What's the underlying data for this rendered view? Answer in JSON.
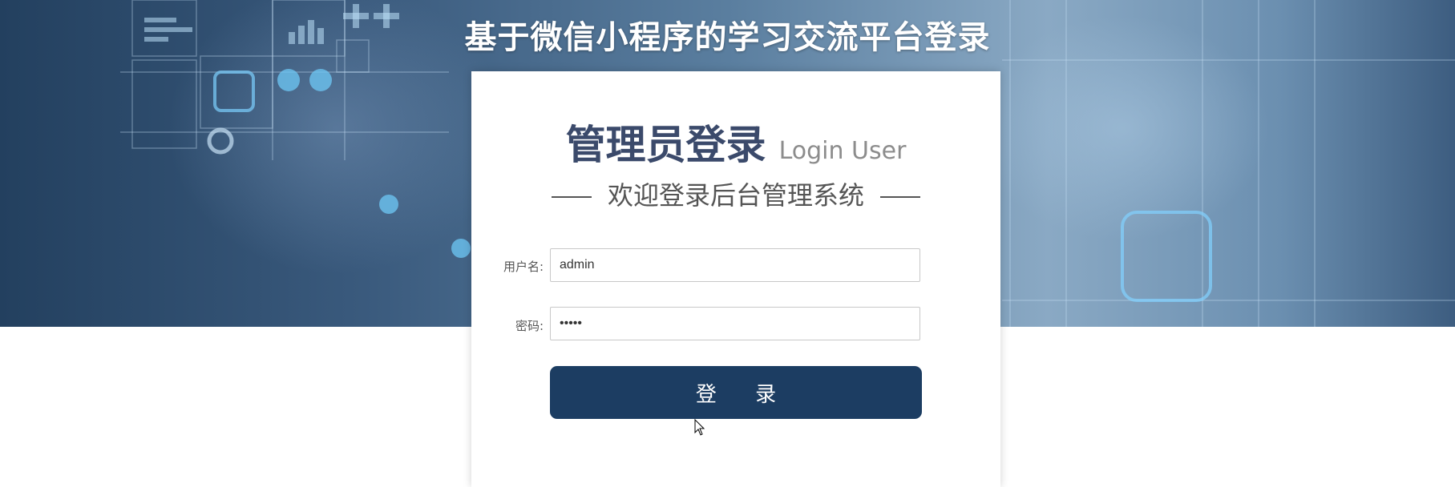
{
  "page": {
    "title": "基于微信小程序的学习交流平台登录"
  },
  "login_card": {
    "heading": "管理员登录",
    "heading_en": "Login User",
    "subtitle": "欢迎登录后台管理系统",
    "username_label": "用户名:",
    "username_value": "admin",
    "password_label": "密码:",
    "password_value": "admin",
    "submit_label": "登 录"
  },
  "colors": {
    "accent_button": "#1c3d62",
    "heading_text": "#3b4a6b"
  }
}
